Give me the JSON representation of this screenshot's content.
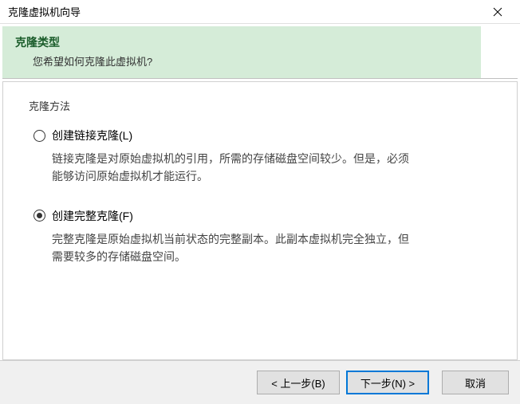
{
  "window": {
    "title": "克隆虚拟机向导"
  },
  "header": {
    "title": "克隆类型",
    "subtitle": "您希望如何克隆此虚拟机?"
  },
  "section": {
    "label": "克隆方法"
  },
  "options": {
    "linked": {
      "label": "创建链接克隆(L)",
      "description": "链接克隆是对原始虚拟机的引用，所需的存储磁盘空间较少。但是，必须能够访问原始虚拟机才能运行。",
      "selected": false
    },
    "full": {
      "label": "创建完整克隆(F)",
      "description": "完整克隆是原始虚拟机当前状态的完整副本。此副本虚拟机完全独立，但需要较多的存储磁盘空间。",
      "selected": true
    }
  },
  "footer": {
    "back": "< 上一步(B)",
    "next": "下一步(N) >",
    "cancel": "取消"
  }
}
